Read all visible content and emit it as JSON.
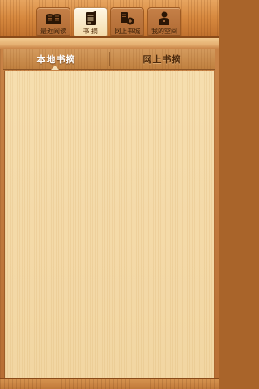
{
  "top_tabs": [
    {
      "label": "最近阅读",
      "icon": "open-book-icon",
      "active": false
    },
    {
      "label": "书  摘",
      "icon": "notepad-icon",
      "active": true
    },
    {
      "label": "网上书城",
      "icon": "bookstore-icon",
      "active": false
    },
    {
      "label": "我的空间",
      "icon": "person-icon",
      "active": false
    }
  ],
  "sub_tabs": {
    "local": "本地书摘",
    "online": "网上书摘",
    "selected": "local"
  },
  "content": {
    "items": []
  },
  "colors": {
    "wood_dark": "#a9642a",
    "wood_light": "#e7a560",
    "paper": "#f6deaf",
    "text_dark": "#3a2008"
  }
}
